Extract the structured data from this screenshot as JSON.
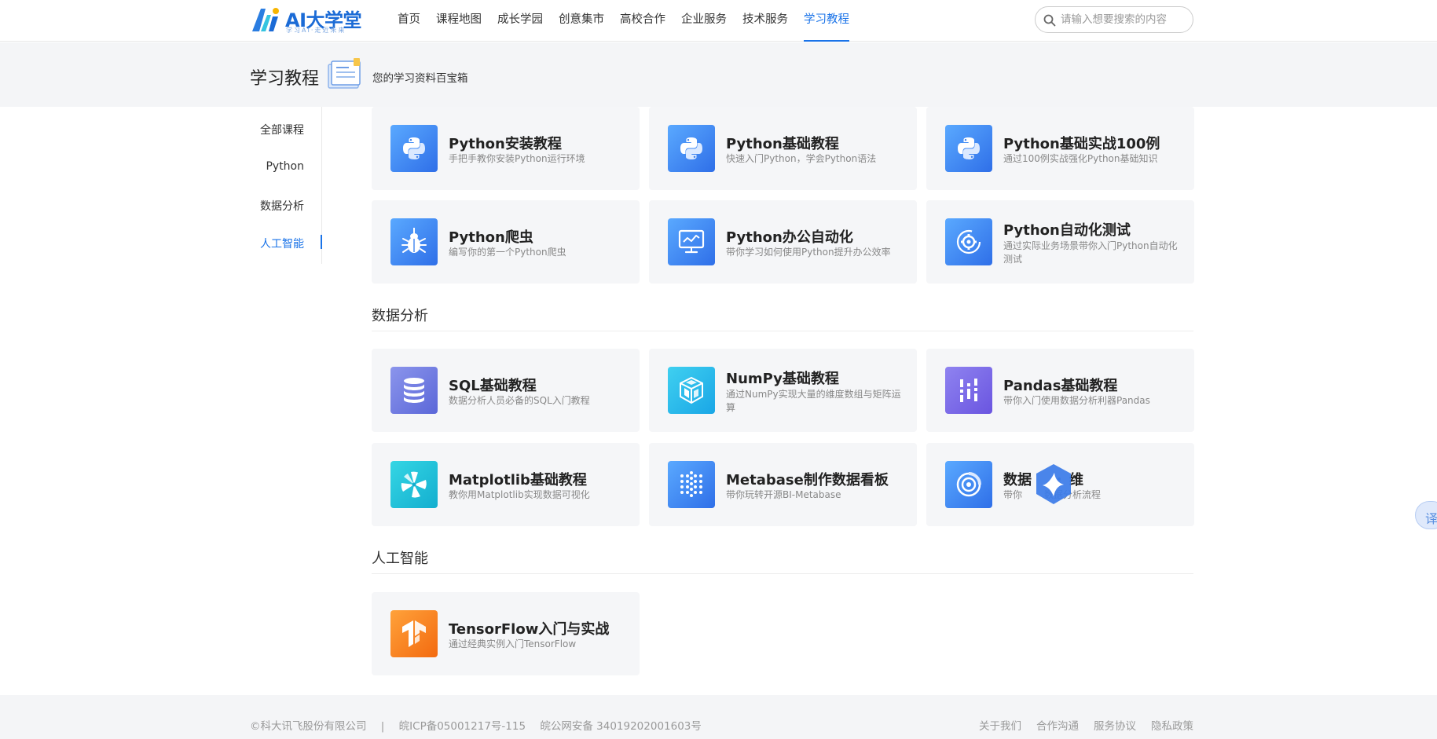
{
  "logo": {
    "text": "AI大学堂",
    "sub": "学习AI·走近未来"
  },
  "nav": [
    {
      "label": "首页",
      "active": false
    },
    {
      "label": "课程地图",
      "active": false
    },
    {
      "label": "成长学园",
      "active": false
    },
    {
      "label": "创意集市",
      "active": false
    },
    {
      "label": "高校合作",
      "active": false
    },
    {
      "label": "企业服务",
      "active": false
    },
    {
      "label": "技术服务",
      "active": false
    },
    {
      "label": "学习教程",
      "active": true
    }
  ],
  "search": {
    "placeholder": "请输入想要搜索的内容"
  },
  "banner": {
    "title": "学习教程",
    "subtitle": "您的学习资料百宝箱"
  },
  "sidebar": [
    {
      "label": "全部课程",
      "active": false
    },
    {
      "label": "Python",
      "active": false
    },
    {
      "label": "数据分析",
      "active": false
    },
    {
      "label": "人工智能",
      "active": true
    }
  ],
  "python_cards": [
    {
      "title": "Python安装教程",
      "desc": "手把手教你安装Python运行环境",
      "icon": "python-icon"
    },
    {
      "title": "Python基础教程",
      "desc": "快速入门Python，学会Python语法",
      "icon": "python-icon"
    },
    {
      "title": "Python基础实战100例",
      "desc": "通过100例实战强化Python基础知识",
      "icon": "python-icon"
    },
    {
      "title": "Python爬虫",
      "desc": "编写你的第一个Python爬虫",
      "icon": "spider-icon"
    },
    {
      "title": "Python办公自动化",
      "desc": "带你学习如何使用Python提升办公效率",
      "icon": "monitor-chart-icon"
    },
    {
      "title": "Python自动化测试",
      "desc": "通过实际业务场景带你入门Python自动化测试",
      "icon": "gear-cycle-icon"
    }
  ],
  "sections": {
    "data_analysis": "数据分析",
    "ai": "人工智能"
  },
  "data_cards": [
    {
      "title": "SQL基础教程",
      "desc": "数据分析人员必备的SQL入门教程",
      "icon": "database-icon"
    },
    {
      "title": "NumPy基础教程",
      "desc": "通过NumPy实现大量的维度数组与矩阵运算",
      "icon": "numpy-cube-icon"
    },
    {
      "title": "Pandas基础教程",
      "desc": "带你入门使用数据分析利器Pandas",
      "icon": "pandas-icon"
    },
    {
      "title": "Matplotlib基础教程",
      "desc": "教你用Matplotlib实现数据可视化",
      "icon": "matplotlib-icon"
    },
    {
      "title": "Metabase制作数据看板",
      "desc": "带你玩转开源BI-Metabase",
      "icon": "metabase-dots-icon"
    },
    {
      "title": "数据",
      "title_tail": "维",
      "desc": "带你",
      "desc_tail": "数据分析流程",
      "icon": "analysis-target-icon"
    }
  ],
  "ai_cards": [
    {
      "title": "TensorFlow入门与实战",
      "desc": "通过经典实例入门TensorFlow",
      "icon": "tensorflow-icon"
    }
  ],
  "float": {
    "translate_label": "译"
  },
  "footer": {
    "copyright": "©科大讯飞股份有限公司",
    "sep": "|",
    "icp": "皖ICP备05001217号-115",
    "police": "皖公网安备 34019202001603号",
    "links": [
      "关于我们",
      "合作沟通",
      "服务协议",
      "隐私政策"
    ]
  },
  "colors": {
    "accent": "#1a73e8",
    "banner_bg": "#f4f5f7",
    "card_bg": "#f5f6f8"
  }
}
